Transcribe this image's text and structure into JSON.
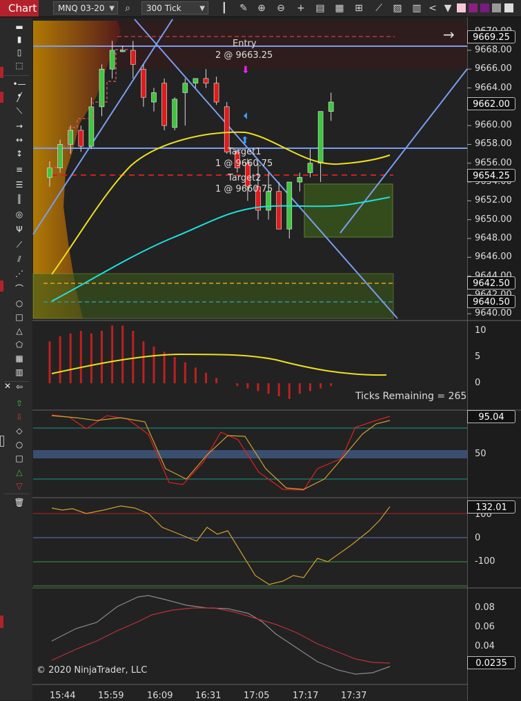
{
  "toolbar": {
    "tab_label": "Chart",
    "instrument": "MNQ 03-20",
    "bar_type": "300 Tick",
    "icons": [
      "search-icon",
      "bar-type-icon",
      "pencil-icon",
      "zoom-in-icon",
      "zoom-out-icon",
      "crosshair-icon",
      "properties-icon",
      "strategies-icon",
      "indicators-icon",
      "drawing-tools-icon",
      "templates-icon",
      "data-box-icon",
      "scroll-left-icon",
      "dropdown-icon",
      "color-swatch-icon"
    ]
  },
  "sidebar": {
    "icons": [
      "ruler-icon",
      "pointer-icon",
      "box-icon",
      "dotted-box-icon",
      "line-icon",
      "ray-icon",
      "extended-line-icon",
      "arrow-line-icon",
      "horizontal-line-icon",
      "vertical-line-icon",
      "fib-retracement-icon",
      "fib-extension-icon",
      "fib-time-icon",
      "fib-circle-icon",
      "andrews-pitchfork-icon",
      "gann-fan-icon",
      "regression-channel-icon",
      "risk-reward-icon",
      "time-cycles-icon",
      "ellipse-icon",
      "rectangle-icon",
      "triangle-icon",
      "polygon-icon",
      "region-highlight-icon",
      "text-icon",
      "arrow-up-icon",
      "arrow-down-icon",
      "diamond-icon",
      "dot-icon",
      "square-icon",
      "triangle-up-icon",
      "triangle-down-icon",
      "trash-icon"
    ]
  },
  "price_panel": {
    "axis_ticks": [
      "9670.00",
      "9668.00",
      "9666.00",
      "9664.00",
      "9662.00",
      "9660.00",
      "9658.00",
      "9656.00",
      "9654.00",
      "9652.00",
      "9650.00",
      "9648.00",
      "9646.00",
      "9644.00",
      "9642.00",
      "9640.00"
    ],
    "price_boxes": [
      "9669.25",
      "9662.00",
      "9654.25",
      "9642.50",
      "9640.50"
    ],
    "labels": {
      "entry_title": "Entry",
      "entry_detail": "2 @ 9663.25",
      "target1_title": "Target1",
      "target1_detail": "1 @ 9660.75",
      "target2_title": "Target2",
      "target2_detail": "1 @ 9660.75"
    }
  },
  "volume_panel": {
    "axis_ticks": [
      "10",
      "5",
      "0"
    ],
    "note": "Ticks Remaining = 265"
  },
  "stoch_panel": {
    "axis_ticks": [
      "50"
    ],
    "price_box": "95.04"
  },
  "cci_panel": {
    "axis_ticks": [
      "100",
      "0",
      "-100"
    ],
    "price_box": "132.01"
  },
  "osc_panel": {
    "axis_ticks": [
      "0.08",
      "0.06",
      "0.04"
    ],
    "price_box": "0.0235"
  },
  "x_axis": [
    "15:44",
    "15:59",
    "16:09",
    "16:31",
    "17:05",
    "17:17",
    "17:37"
  ],
  "copyright": "© 2020 NinjaTrader, LLC",
  "chart_data": {
    "type": "candlestick",
    "candles": [
      {
        "o": 9654.5,
        "h": 9656.2,
        "l": 9653.5,
        "c": 9655.5
      },
      {
        "o": 9655.5,
        "h": 9658.5,
        "l": 9655.0,
        "c": 9658.0
      },
      {
        "o": 9658.0,
        "h": 9660.0,
        "l": 9657.0,
        "c": 9659.5
      },
      {
        "o": 9659.5,
        "h": 9660.0,
        "l": 9657.2,
        "c": 9657.8
      },
      {
        "o": 9657.8,
        "h": 9663.0,
        "l": 9657.5,
        "c": 9662.0
      },
      {
        "o": 9662.0,
        "h": 9666.5,
        "l": 9661.0,
        "c": 9666.0
      },
      {
        "o": 9666.0,
        "h": 9669.0,
        "l": 9665.0,
        "c": 9668.0
      },
      {
        "o": 9668.0,
        "h": 9668.5,
        "l": 9667.8,
        "c": 9668.0
      },
      {
        "o": 9668.0,
        "h": 9669.0,
        "l": 9665.0,
        "c": 9666.5
      },
      {
        "o": 9666.0,
        "h": 9666.5,
        "l": 9662.0,
        "c": 9663.0
      },
      {
        "o": 9662.5,
        "h": 9664.0,
        "l": 9661.5,
        "c": 9663.5
      },
      {
        "o": 9664.5,
        "h": 9665.0,
        "l": 9659.5,
        "c": 9660.0
      },
      {
        "o": 9659.8,
        "h": 9663.0,
        "l": 9659.5,
        "c": 9662.8
      },
      {
        "o": 9663.5,
        "h": 9665.0,
        "l": 9660.0,
        "c": 9664.5
      },
      {
        "o": 9664.5,
        "h": 9665.0,
        "l": 9664.0,
        "c": 9665.0
      },
      {
        "o": 9665.0,
        "h": 9666.0,
        "l": 9664.0,
        "c": 9664.5
      },
      {
        "o": 9664.5,
        "h": 9665.2,
        "l": 9662.2,
        "c": 9662.5
      },
      {
        "o": 9662.0,
        "h": 9662.5,
        "l": 9657.0,
        "c": 9657.2
      },
      {
        "o": 9657.2,
        "h": 9657.5,
        "l": 9655.0,
        "c": 9655.5
      },
      {
        "o": 9656.0,
        "h": 9656.5,
        "l": 9652.0,
        "c": 9653.5
      },
      {
        "o": 9653.5,
        "h": 9656.0,
        "l": 9650.0,
        "c": 9651.0
      },
      {
        "o": 9651.0,
        "h": 9655.0,
        "l": 9650.0,
        "c": 9653.0
      },
      {
        "o": 9653.0,
        "h": 9654.0,
        "l": 9650.5,
        "c": 9649.0
      },
      {
        "o": 9649.0,
        "h": 9654.0,
        "l": 9648.0,
        "c": 9654.0
      },
      {
        "o": 9654.0,
        "h": 9655.0,
        "l": 9653.0,
        "c": 9654.5
      },
      {
        "o": 9655.0,
        "h": 9657.5,
        "l": 9654.5,
        "c": 9656.0
      },
      {
        "o": 9656.0,
        "h": 9661.5,
        "l": 9654.0,
        "c": 9661.5
      },
      {
        "o": 9661.5,
        "h": 9663.5,
        "l": 9660.5,
        "c": 9662.5
      }
    ],
    "volume_histogram": [
      8,
      9,
      9.5,
      10,
      9.5,
      10,
      11,
      11,
      10,
      8,
      7,
      6,
      5,
      4,
      3,
      2,
      1,
      0,
      -0.5,
      -1,
      -1.5,
      -2,
      -2.5,
      -3,
      -2,
      -1.5,
      -1,
      -0.5
    ],
    "ylim": [
      9639.5,
      9671
    ]
  }
}
